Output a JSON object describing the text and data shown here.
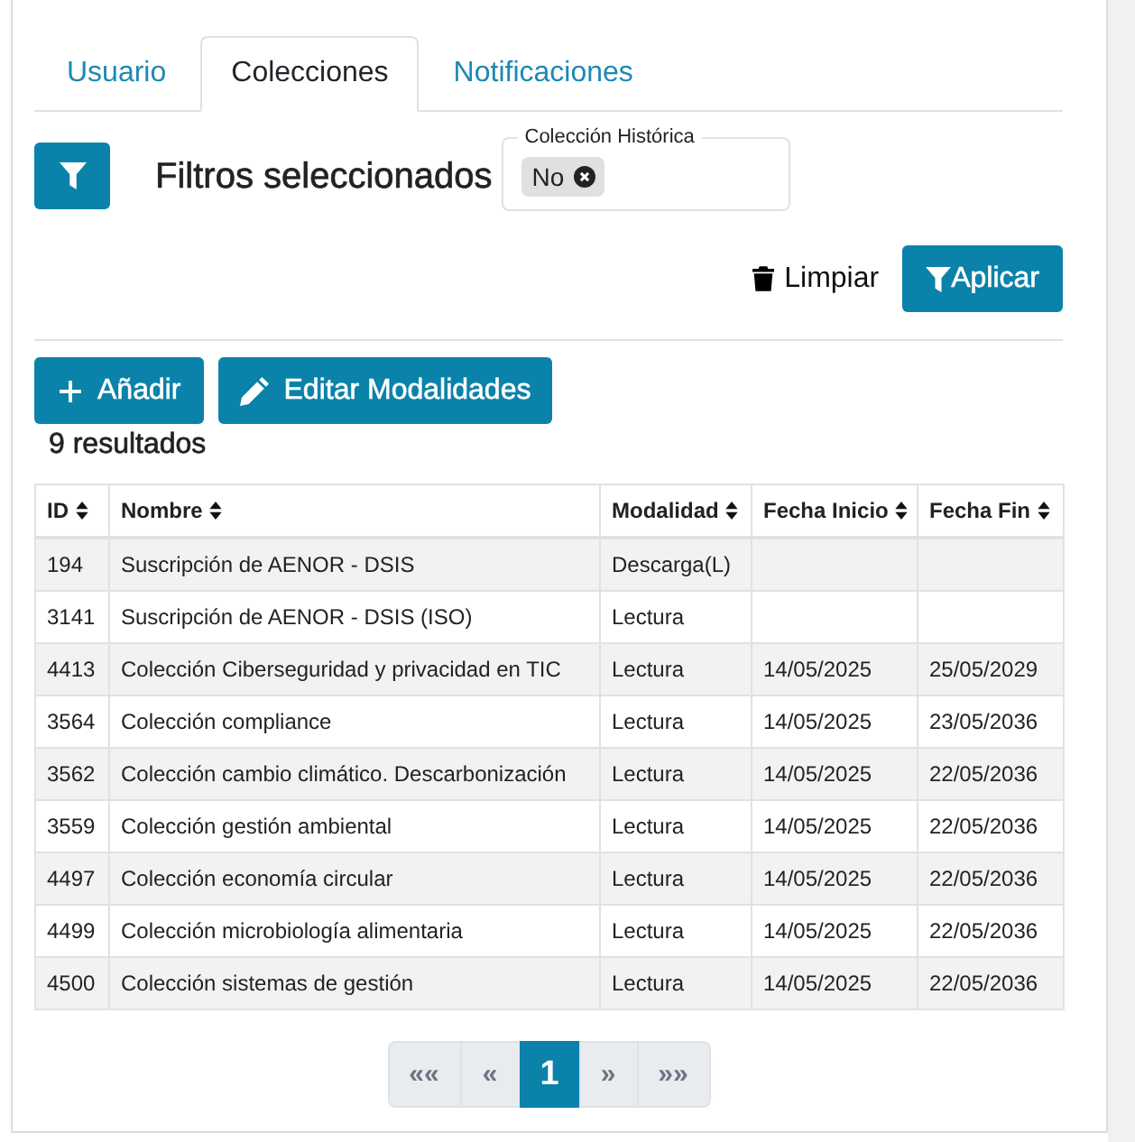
{
  "tabs": [
    {
      "label": "Usuario",
      "selected": false
    },
    {
      "label": "Colecciones",
      "selected": true
    },
    {
      "label": "Notificaciones",
      "selected": false
    }
  ],
  "filters": {
    "title": "Filtros seleccionados",
    "fields": [
      {
        "label": "Colección Histórica",
        "chips": [
          "No"
        ]
      }
    ],
    "actions": [
      {
        "kind": "clear",
        "label": "Limpiar"
      },
      {
        "kind": "apply",
        "label": "Aplicar"
      }
    ]
  },
  "toolbar": [
    {
      "kind": "add",
      "label": "Añadir"
    },
    {
      "kind": "edit",
      "label": "Editar Modalidades"
    }
  ],
  "result_count": "9 resultados",
  "table": {
    "columns": [
      {
        "label": "ID",
        "sortable": true
      },
      {
        "label": "Nombre",
        "sortable": true
      },
      {
        "label": "Modalidad",
        "sortable": true
      },
      {
        "label": "Fecha Inicio",
        "sortable": true
      },
      {
        "label": "Fecha Fin",
        "sortable": true
      }
    ],
    "rows": [
      [
        "194",
        "Suscripción de AENOR - DSIS",
        "Descarga(L)"
      ],
      [
        "3141",
        "Suscripción de AENOR - DSIS (ISO)",
        "Lectura"
      ],
      [
        "4413",
        "Colección Ciberseguridad y privacidad en TIC",
        "Lectura",
        "14/05/2025",
        "25/05/2029"
      ],
      [
        "3564",
        "Colección compliance",
        "Lectura",
        "14/05/2025",
        "23/05/2036"
      ],
      [
        "3562",
        "Colección cambio climático. Descarbonización",
        "Lectura",
        "14/05/2025",
        "22/05/2036"
      ],
      [
        "3559",
        "Colección gestión ambiental",
        "Lectura",
        "14/05/2025",
        "22/05/2036"
      ],
      [
        "4497",
        "Colección economía circular",
        "Lectura",
        "14/05/2025",
        "22/05/2036"
      ],
      [
        "4499",
        "Colección microbiología alimentaria",
        "Lectura",
        "14/05/2025",
        "22/05/2036"
      ],
      [
        "4500",
        "Colección sistemas de gestión",
        "Lectura",
        "14/05/2025",
        "22/05/2036"
      ]
    ]
  },
  "pagination": [
    {
      "kind": "first",
      "label": "««",
      "selected": false
    },
    {
      "kind": "prev",
      "label": "«",
      "selected": false
    },
    {
      "kind": "page",
      "label": "1",
      "selected": true
    },
    {
      "kind": "next",
      "label": "»",
      "selected": false
    },
    {
      "kind": "last",
      "label": "»»",
      "selected": false
    }
  ]
}
